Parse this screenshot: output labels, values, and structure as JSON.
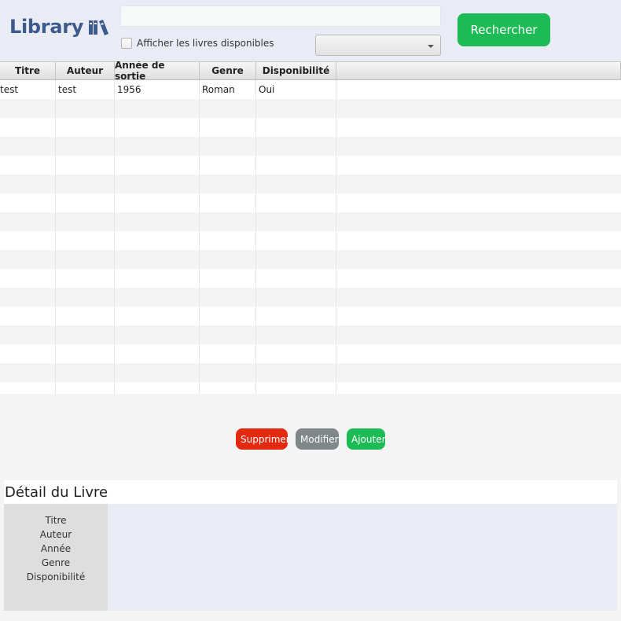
{
  "header": {
    "logo_text": "Library",
    "logo_icon": "books-icon",
    "search": {
      "value": "",
      "placeholder": ""
    },
    "checkbox_label": "Afficher les livres disponibles",
    "checkbox_checked": false,
    "genre_select": {
      "selected": ""
    },
    "search_button_label": "Rechercher"
  },
  "table": {
    "columns": [
      "Titre",
      "Auteur",
      "Année de sortie",
      "Genre",
      "Disponibilité"
    ],
    "rows": [
      [
        "test",
        "test",
        "1956",
        "Roman",
        "Oui"
      ]
    ]
  },
  "actions": {
    "delete_label": "Supprimer",
    "edit_label": "Modifier",
    "add_label": "Ajouter"
  },
  "detail": {
    "title": "Détail du Livre",
    "labels": [
      "Titre",
      "Auteur",
      "Année",
      "Genre",
      "Disponibilité"
    ]
  },
  "colors": {
    "header_bg": "#e9ecf4",
    "brand": "#3d5a8c",
    "green": "#1dbb55",
    "red": "#e3290f",
    "gray": "#7f8789"
  }
}
